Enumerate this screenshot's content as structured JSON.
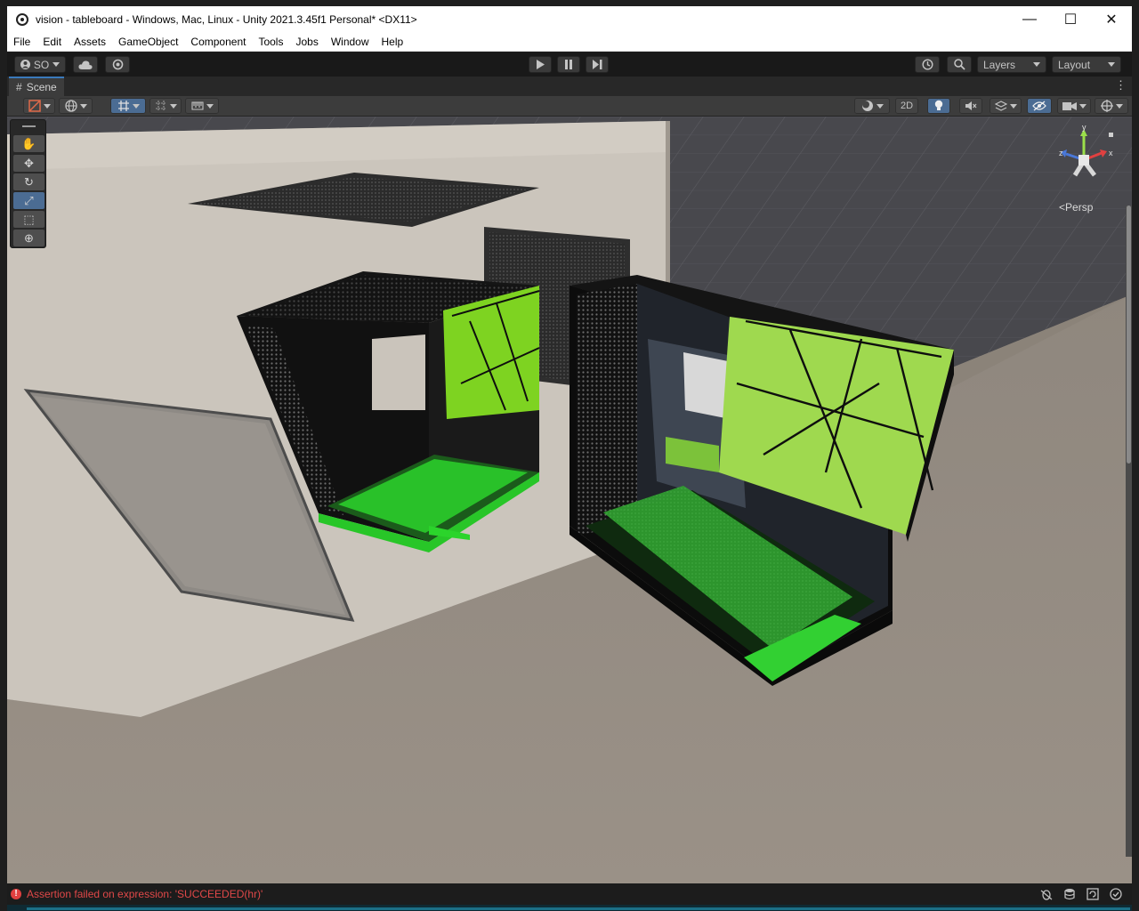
{
  "window": {
    "title": "vision - tableboard - Windows, Mac, Linux - Unity 2021.3.45f1 Personal* <DX11>",
    "minimize_glyph": "—",
    "maximize_glyph": "☐",
    "close_glyph": "✕"
  },
  "menu": [
    "File",
    "Edit",
    "Assets",
    "GameObject",
    "Component",
    "Tools",
    "Jobs",
    "Window",
    "Help"
  ],
  "toolbar": {
    "account_label": "SO",
    "layers_label": "Layers",
    "layout_label": "Layout"
  },
  "scene_tab": {
    "label": "Scene"
  },
  "scene_toolbar": {
    "mode_2d_label": "2D"
  },
  "viewport": {
    "gizmo_axes": {
      "y": "y",
      "x": "x",
      "z": "z"
    },
    "projection_label": "Persp",
    "persp_chevron": "<"
  },
  "status": {
    "message": "Assertion failed on expression: 'SUCCEEDED(hr)'"
  },
  "colors": {
    "accent_blue": "#4b6c93",
    "error_red": "#e04848",
    "case_green": "#3cd83c",
    "panel_green": "#9bd84a"
  }
}
